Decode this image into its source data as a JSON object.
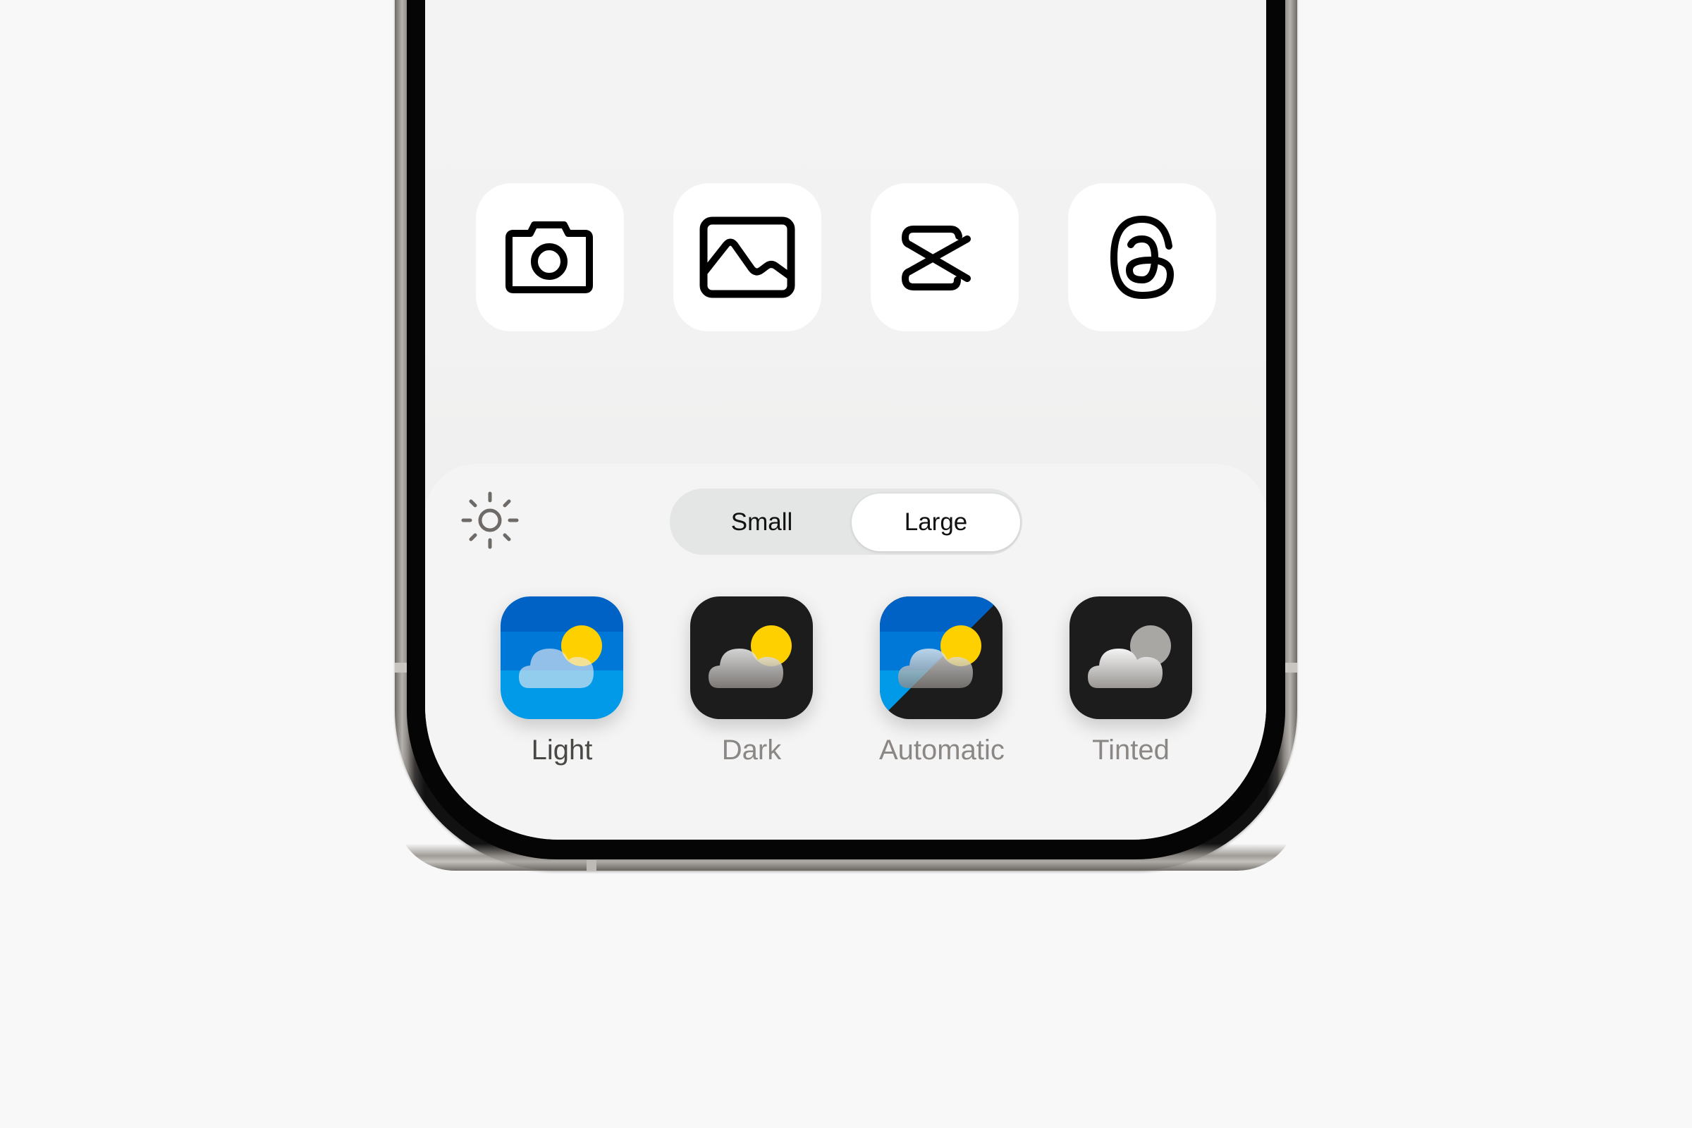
{
  "home_screen": {
    "apps": [
      {
        "name": "Camera",
        "icon": "camera-icon"
      },
      {
        "name": "Photos",
        "icon": "photo-icon"
      },
      {
        "name": "CapCut",
        "icon": "capcut-icon"
      },
      {
        "name": "Threads",
        "icon": "threads-icon"
      }
    ]
  },
  "customize_panel": {
    "brightness_icon": "sun-icon",
    "size_control": {
      "options": [
        "Small",
        "Large"
      ],
      "selected": "Large"
    },
    "styles": [
      {
        "label": "Light",
        "selected": true,
        "icon": "weather-light-icon"
      },
      {
        "label": "Dark",
        "selected": false,
        "icon": "weather-dark-icon"
      },
      {
        "label": "Automatic",
        "selected": false,
        "icon": "weather-automatic-icon"
      },
      {
        "label": "Tinted",
        "selected": false,
        "icon": "weather-tinted-icon"
      }
    ]
  },
  "colors": {
    "light_sky_top": "#0062c4",
    "light_sky_bottom": "#009ae8",
    "sun": "#ffd000",
    "dark_bg": "#1c1c1c"
  }
}
